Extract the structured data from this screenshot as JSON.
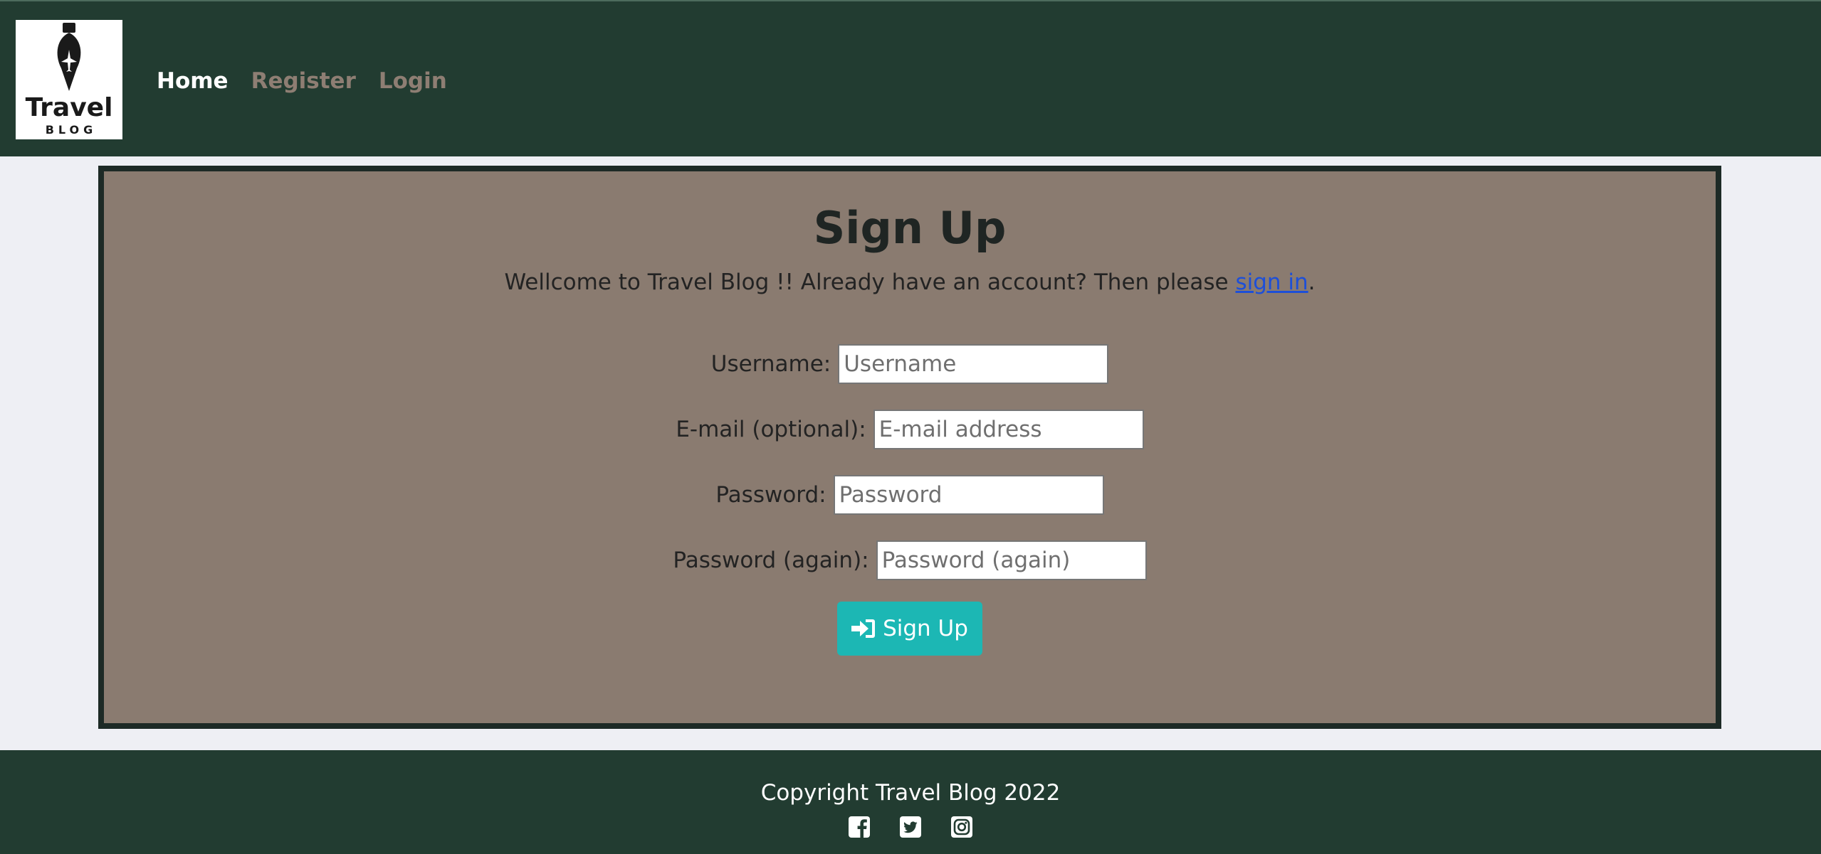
{
  "brand": {
    "logo_title": "Travel",
    "logo_subtitle": "BLOG"
  },
  "nav": {
    "items": [
      {
        "label": "Home",
        "state": "active"
      },
      {
        "label": "Register",
        "state": "muted"
      },
      {
        "label": "Login",
        "state": "muted"
      }
    ]
  },
  "signup": {
    "title": "Sign Up",
    "intro_text": "Wellcome to Travel Blog !! Already have an account? Then please ",
    "intro_link": "sign in",
    "intro_end": ".",
    "fields": {
      "username": {
        "label": "Username:",
        "placeholder": "Username"
      },
      "email": {
        "label": "E-mail (optional):",
        "placeholder": "E-mail address"
      },
      "password": {
        "label": "Password:",
        "placeholder": "Password"
      },
      "password2": {
        "label": "Password (again):",
        "placeholder": "Password (again)"
      }
    },
    "submit_icon": "sign-in-icon",
    "submit_label": "Sign Up"
  },
  "footer": {
    "copyright": "Copyright Travel Blog 2022",
    "socials": [
      "facebook-icon",
      "twitter-icon",
      "instagram-icon"
    ]
  },
  "colors": {
    "navbar": "#223c31",
    "panel": "#8a7b70",
    "button": "#1cb7b4",
    "link": "#1d4fd8"
  }
}
